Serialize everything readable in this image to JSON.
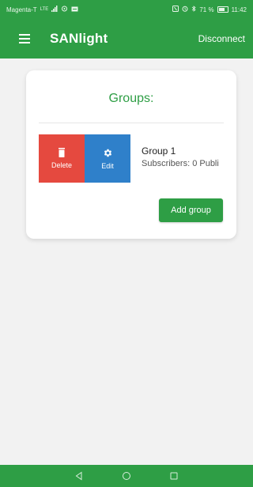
{
  "status_bar": {
    "carrier": "Magenta-T",
    "network": "LTE",
    "right_text": "71 %",
    "time": "11:42",
    "icons": [
      "signal-icon",
      "usb-icon",
      "nfc-icon",
      "alarm-icon",
      "bluetooth-icon",
      "battery-icon"
    ]
  },
  "app_bar": {
    "title": "SANlight",
    "disconnect_label": "Disconnect"
  },
  "card": {
    "title": "Groups:",
    "groups": [
      {
        "name": "Group 1",
        "subtitle": "Subscribers: 0 Publi",
        "delete_label": "Delete",
        "edit_label": "Edit"
      }
    ],
    "add_group_label": "Add group"
  },
  "nav_bar": {
    "buttons": [
      "back-icon",
      "home-icon",
      "recents-icon"
    ]
  },
  "colors": {
    "primary": "#2e9e45",
    "delete": "#e5493f",
    "edit": "#2f80ca",
    "background": "#f2f2f2"
  }
}
